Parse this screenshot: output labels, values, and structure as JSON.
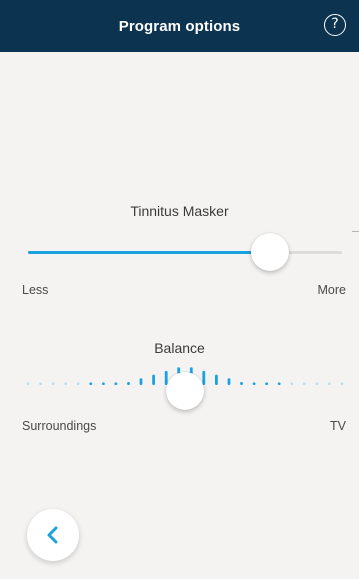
{
  "header": {
    "title": "Program options",
    "help_glyph": "?",
    "help_icon": "question-circle-icon"
  },
  "masker": {
    "title": "Tinnitus Masker",
    "min_label": "Less",
    "max_label": "More",
    "value_fraction": 0.77
  },
  "balance": {
    "title": "Balance",
    "min_label": "Surroundings",
    "max_label": "TV",
    "value_fraction": 0.5
  },
  "footer": {
    "back_icon": "chevron-left-icon"
  },
  "colors": {
    "header_bg": "#0c3350",
    "accent": "#19a2e0",
    "accent_light": "#b7dff2",
    "background": "#f4f3f2"
  }
}
